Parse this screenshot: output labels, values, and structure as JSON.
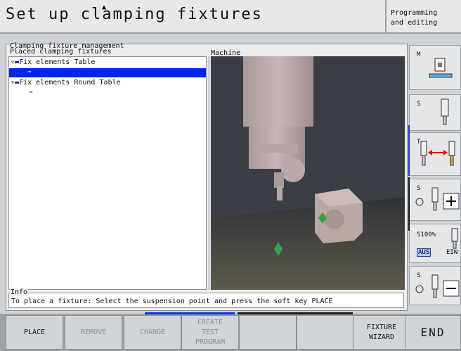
{
  "header": {
    "title": "Set up clamping fixtures",
    "mode_line1": "Programming",
    "mode_line2": "and editing"
  },
  "panel": {
    "management_label": "Clamping fixture management",
    "placed_label": "Placed clamping fixtures",
    "tree": [
      {
        "label": "Fix elements Table"
      },
      {
        "label": "Fix elements Round Table"
      }
    ],
    "machine_label": "Machine"
  },
  "info": {
    "label": "Info",
    "text": "To place a fixture: Select the suspension point and press the soft key PLACE"
  },
  "side_softkeys": {
    "m_label": "M",
    "s_label": "S",
    "t_label": "T",
    "s_plus_label": "S",
    "s100_label": "S100%",
    "aus_label": "AUS",
    "ein_label": "EIN",
    "s_minus_label": "S"
  },
  "softkeys": {
    "place": "PLACE",
    "remove": "REMOVE",
    "change": "CHANGE",
    "create_1": "CREATE",
    "create_2": "TEST",
    "create_3": "PROGRAM",
    "wizard_1": "FIXTURE",
    "wizard_2": "WIZARD",
    "end": "END"
  },
  "colors": {
    "selection": "#0026e6",
    "viewport_bg": "#3b3e44",
    "spindle": "#c0aeae"
  }
}
